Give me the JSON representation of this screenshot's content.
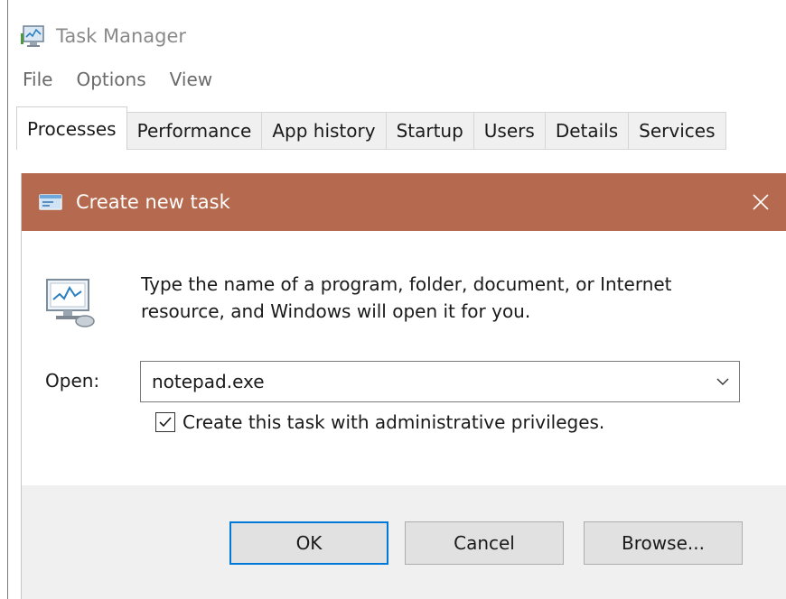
{
  "task_manager": {
    "title": "Task Manager",
    "icon": "task-manager-icon",
    "menu": [
      "File",
      "Options",
      "View"
    ],
    "tabs": [
      {
        "label": "Processes",
        "active": true
      },
      {
        "label": "Performance",
        "active": false
      },
      {
        "label": "App history",
        "active": false
      },
      {
        "label": "Startup",
        "active": false
      },
      {
        "label": "Users",
        "active": false
      },
      {
        "label": "Details",
        "active": false
      },
      {
        "label": "Services",
        "active": false
      }
    ]
  },
  "dialog": {
    "title": "Create new task",
    "title_icon": "run-dialog-icon",
    "close_icon": "close-icon",
    "titlebar_color": "#b56a4f",
    "message": "Type the name of a program, folder, document, or Internet resource, and Windows will open it for you.",
    "open_label": "Open:",
    "open_value": "notepad.exe",
    "admin_checkbox": {
      "label": "Create this task with administrative privileges.",
      "checked": true
    },
    "buttons": {
      "ok": "OK",
      "cancel": "Cancel",
      "browse": "Browse..."
    }
  },
  "colors": {
    "accent": "#0078d7",
    "footer_bg": "#f0f0f0"
  }
}
